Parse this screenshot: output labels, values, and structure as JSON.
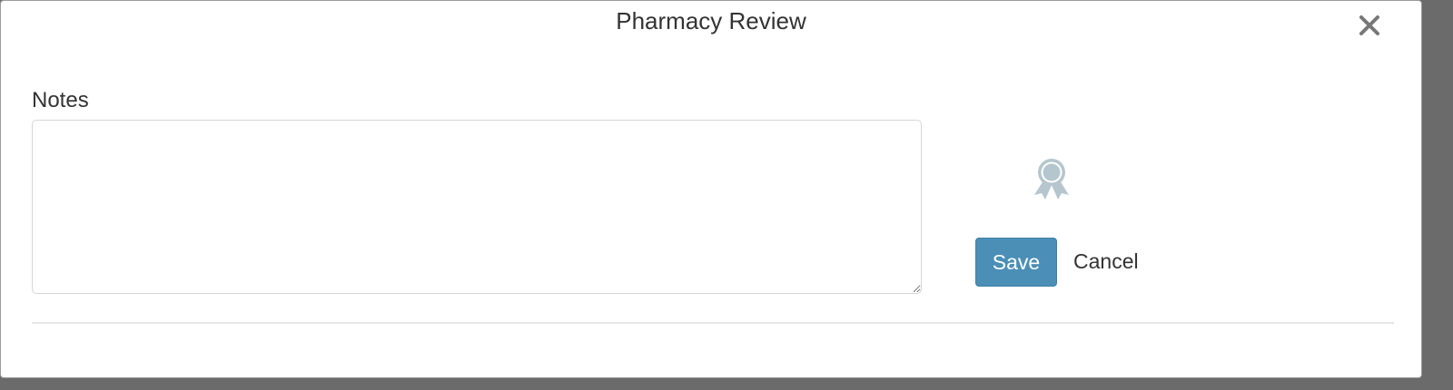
{
  "dialog": {
    "title": "Pharmacy Review",
    "close_icon": "close-icon"
  },
  "form": {
    "notes_label": "Notes",
    "notes_value": "",
    "notes_placeholder": ""
  },
  "actions": {
    "badge_icon": "award-ribbon-icon",
    "save_label": "Save",
    "cancel_label": "Cancel"
  },
  "colors": {
    "primary": "#4b8fb7",
    "icon_muted": "#b5c6ce",
    "text": "#333333",
    "close_icon": "#777777"
  }
}
